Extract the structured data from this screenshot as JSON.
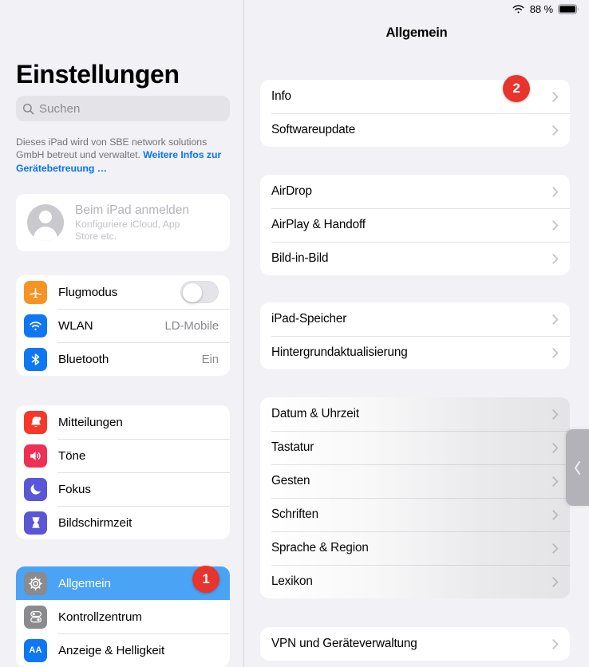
{
  "statusbar": {
    "wifi_icon": "wifi-icon",
    "battery_percent": "88 %",
    "battery_icon": "battery-full-icon"
  },
  "sidebar": {
    "title": "Einstellungen",
    "search": {
      "placeholder": "Suchen",
      "icon": "search-icon"
    },
    "managed_note": {
      "text": "Dieses iPad wird von SBE network solutions GmbH betreut und verwaltet. ",
      "link": "Weitere Infos zur Gerätebetreuung …"
    },
    "signin": {
      "icon": "avatar-placeholder-icon",
      "title": "Beim iPad anmelden",
      "subtitle": "Konfiguriere iCloud, App Store etc."
    },
    "groups": [
      {
        "name": "connectivity",
        "rows": [
          {
            "label": "Flugmodus",
            "icon": "airplane-icon",
            "icon_color": "#f59425",
            "control": "toggle",
            "toggle_on": false
          },
          {
            "label": "WLAN",
            "icon": "wifi-icon",
            "icon_color": "#1077f3",
            "value": "LD-Mobile"
          },
          {
            "label": "Bluetooth",
            "icon": "bluetooth-icon",
            "icon_color": "#1077f3",
            "value": "Ein"
          }
        ]
      },
      {
        "name": "notifications",
        "rows": [
          {
            "label": "Mitteilungen",
            "icon": "bell-icon",
            "icon_color": "#f6372a"
          },
          {
            "label": "Töne",
            "icon": "speaker-icon",
            "icon_color": "#ef3056"
          },
          {
            "label": "Fokus",
            "icon": "moon-icon",
            "icon_color": "#5a56d6"
          },
          {
            "label": "Bildschirmzeit",
            "icon": "hourglass-icon",
            "icon_color": "#5a56d6"
          }
        ]
      },
      {
        "name": "system",
        "rows": [
          {
            "label": "Allgemein",
            "icon": "gear-icon",
            "icon_color": "#8a8a8f",
            "selected": true
          },
          {
            "label": "Kontrollzentrum",
            "icon": "control-center-icon",
            "icon_color": "#8a8a8f"
          },
          {
            "label": "Anzeige & Helligkeit",
            "icon": "text-size-icon",
            "icon_color": "#1077f3"
          }
        ]
      }
    ]
  },
  "detail": {
    "title": "Allgemein",
    "groups": [
      {
        "name": "about",
        "rows": [
          {
            "label": "Info"
          },
          {
            "label": "Softwareupdate"
          }
        ]
      },
      {
        "name": "sharing",
        "rows": [
          {
            "label": "AirDrop"
          },
          {
            "label": "AirPlay & Handoff"
          },
          {
            "label": "Bild-in-Bild"
          }
        ]
      },
      {
        "name": "storage",
        "rows": [
          {
            "label": "iPad-Speicher"
          },
          {
            "label": "Hintergrundaktualisierung"
          }
        ]
      },
      {
        "name": "preferences",
        "rows": [
          {
            "label": "Datum & Uhrzeit"
          },
          {
            "label": "Tastatur"
          },
          {
            "label": "Gesten"
          },
          {
            "label": "Schriften"
          },
          {
            "label": "Sprache & Region"
          },
          {
            "label": "Lexikon"
          }
        ]
      },
      {
        "name": "management",
        "rows": [
          {
            "label": "VPN und Geräteverwaltung"
          }
        ]
      }
    ],
    "drag_handle_icon": "chevron-left-icon"
  },
  "badges": [
    {
      "label": "1",
      "target": "sidebar-item-allgemein"
    },
    {
      "label": "2",
      "target": "detail-row-info"
    }
  ],
  "colors": {
    "accent_blue": "#1077f3",
    "selection_blue": "#4ba3f5",
    "badge_red": "#e8342c",
    "background": "#f1f1f6",
    "card": "#ffffff"
  }
}
